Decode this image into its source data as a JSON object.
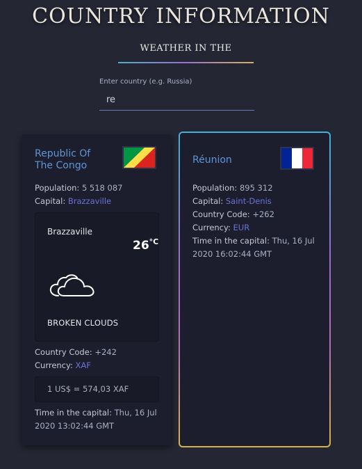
{
  "header": {
    "title": "COUNTRY INFORMATION",
    "subtitle": "WEATHER IN THE"
  },
  "search": {
    "label": "Enter country (e.g. Russia)",
    "value": "re"
  },
  "cards": [
    {
      "name": "Republic Of The Congo",
      "flag": "congo-flag-icon",
      "population_label": "Population:",
      "population": "5 518 087",
      "capital_label": "Capital:",
      "capital": "Brazzaville",
      "weather": {
        "city": "Brazzaville",
        "temp": "26",
        "unit": "°C",
        "icon": "cloud-icon",
        "description": "BROKEN CLOUDS"
      },
      "code_label": "Country Code:",
      "code": "+242",
      "currency_label": "Currency:",
      "currency": "XAF",
      "rate": "1 US$ = 574,03 XAF",
      "time_label": "Time in the capital:",
      "time_line1": "Thu, 16 Jul",
      "time_line2": "2020 13:02:44 GMT"
    },
    {
      "name": "Réunion",
      "flag": "france-flag-icon",
      "population_label": "Population:",
      "population": "895 312",
      "capital_label": "Capital:",
      "capital": "Saint-Denis",
      "code_label": "Country Code:",
      "code": "+262",
      "currency_label": "Currency:",
      "currency": "EUR",
      "time_label": "Time in the capital:",
      "time_line1": "Thu, 16 Jul",
      "time_line2": "2020 16:02:44 GMT"
    }
  ],
  "colors": {
    "background": "#252634",
    "card": "#1d1e2d",
    "accent_link": "#6a72d8",
    "country_name": "#5f95d6"
  }
}
